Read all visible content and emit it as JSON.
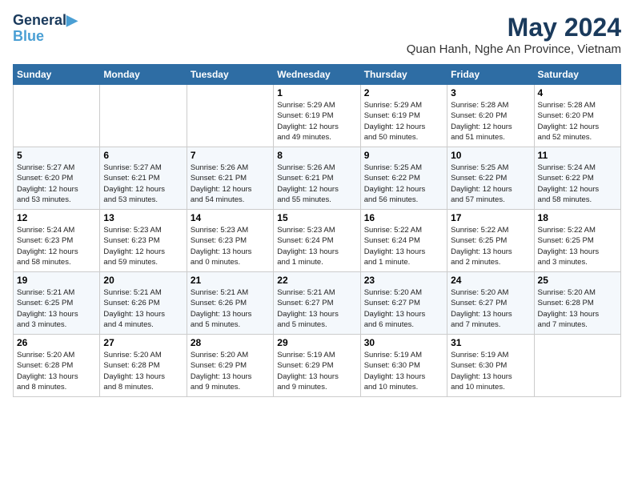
{
  "header": {
    "logo_line1": "General",
    "logo_line2": "Blue",
    "month": "May 2024",
    "location": "Quan Hanh, Nghe An Province, Vietnam"
  },
  "weekdays": [
    "Sunday",
    "Monday",
    "Tuesday",
    "Wednesday",
    "Thursday",
    "Friday",
    "Saturday"
  ],
  "weeks": [
    [
      {
        "day": "",
        "info": ""
      },
      {
        "day": "",
        "info": ""
      },
      {
        "day": "",
        "info": ""
      },
      {
        "day": "1",
        "info": "Sunrise: 5:29 AM\nSunset: 6:19 PM\nDaylight: 12 hours\nand 49 minutes."
      },
      {
        "day": "2",
        "info": "Sunrise: 5:29 AM\nSunset: 6:19 PM\nDaylight: 12 hours\nand 50 minutes."
      },
      {
        "day": "3",
        "info": "Sunrise: 5:28 AM\nSunset: 6:20 PM\nDaylight: 12 hours\nand 51 minutes."
      },
      {
        "day": "4",
        "info": "Sunrise: 5:28 AM\nSunset: 6:20 PM\nDaylight: 12 hours\nand 52 minutes."
      }
    ],
    [
      {
        "day": "5",
        "info": "Sunrise: 5:27 AM\nSunset: 6:20 PM\nDaylight: 12 hours\nand 53 minutes."
      },
      {
        "day": "6",
        "info": "Sunrise: 5:27 AM\nSunset: 6:21 PM\nDaylight: 12 hours\nand 53 minutes."
      },
      {
        "day": "7",
        "info": "Sunrise: 5:26 AM\nSunset: 6:21 PM\nDaylight: 12 hours\nand 54 minutes."
      },
      {
        "day": "8",
        "info": "Sunrise: 5:26 AM\nSunset: 6:21 PM\nDaylight: 12 hours\nand 55 minutes."
      },
      {
        "day": "9",
        "info": "Sunrise: 5:25 AM\nSunset: 6:22 PM\nDaylight: 12 hours\nand 56 minutes."
      },
      {
        "day": "10",
        "info": "Sunrise: 5:25 AM\nSunset: 6:22 PM\nDaylight: 12 hours\nand 57 minutes."
      },
      {
        "day": "11",
        "info": "Sunrise: 5:24 AM\nSunset: 6:22 PM\nDaylight: 12 hours\nand 58 minutes."
      }
    ],
    [
      {
        "day": "12",
        "info": "Sunrise: 5:24 AM\nSunset: 6:23 PM\nDaylight: 12 hours\nand 58 minutes."
      },
      {
        "day": "13",
        "info": "Sunrise: 5:23 AM\nSunset: 6:23 PM\nDaylight: 12 hours\nand 59 minutes."
      },
      {
        "day": "14",
        "info": "Sunrise: 5:23 AM\nSunset: 6:23 PM\nDaylight: 13 hours\nand 0 minutes."
      },
      {
        "day": "15",
        "info": "Sunrise: 5:23 AM\nSunset: 6:24 PM\nDaylight: 13 hours\nand 1 minute."
      },
      {
        "day": "16",
        "info": "Sunrise: 5:22 AM\nSunset: 6:24 PM\nDaylight: 13 hours\nand 1 minute."
      },
      {
        "day": "17",
        "info": "Sunrise: 5:22 AM\nSunset: 6:25 PM\nDaylight: 13 hours\nand 2 minutes."
      },
      {
        "day": "18",
        "info": "Sunrise: 5:22 AM\nSunset: 6:25 PM\nDaylight: 13 hours\nand 3 minutes."
      }
    ],
    [
      {
        "day": "19",
        "info": "Sunrise: 5:21 AM\nSunset: 6:25 PM\nDaylight: 13 hours\nand 3 minutes."
      },
      {
        "day": "20",
        "info": "Sunrise: 5:21 AM\nSunset: 6:26 PM\nDaylight: 13 hours\nand 4 minutes."
      },
      {
        "day": "21",
        "info": "Sunrise: 5:21 AM\nSunset: 6:26 PM\nDaylight: 13 hours\nand 5 minutes."
      },
      {
        "day": "22",
        "info": "Sunrise: 5:21 AM\nSunset: 6:27 PM\nDaylight: 13 hours\nand 5 minutes."
      },
      {
        "day": "23",
        "info": "Sunrise: 5:20 AM\nSunset: 6:27 PM\nDaylight: 13 hours\nand 6 minutes."
      },
      {
        "day": "24",
        "info": "Sunrise: 5:20 AM\nSunset: 6:27 PM\nDaylight: 13 hours\nand 7 minutes."
      },
      {
        "day": "25",
        "info": "Sunrise: 5:20 AM\nSunset: 6:28 PM\nDaylight: 13 hours\nand 7 minutes."
      }
    ],
    [
      {
        "day": "26",
        "info": "Sunrise: 5:20 AM\nSunset: 6:28 PM\nDaylight: 13 hours\nand 8 minutes."
      },
      {
        "day": "27",
        "info": "Sunrise: 5:20 AM\nSunset: 6:28 PM\nDaylight: 13 hours\nand 8 minutes."
      },
      {
        "day": "28",
        "info": "Sunrise: 5:20 AM\nSunset: 6:29 PM\nDaylight: 13 hours\nand 9 minutes."
      },
      {
        "day": "29",
        "info": "Sunrise: 5:19 AM\nSunset: 6:29 PM\nDaylight: 13 hours\nand 9 minutes."
      },
      {
        "day": "30",
        "info": "Sunrise: 5:19 AM\nSunset: 6:30 PM\nDaylight: 13 hours\nand 10 minutes."
      },
      {
        "day": "31",
        "info": "Sunrise: 5:19 AM\nSunset: 6:30 PM\nDaylight: 13 hours\nand 10 minutes."
      },
      {
        "day": "",
        "info": ""
      }
    ]
  ]
}
